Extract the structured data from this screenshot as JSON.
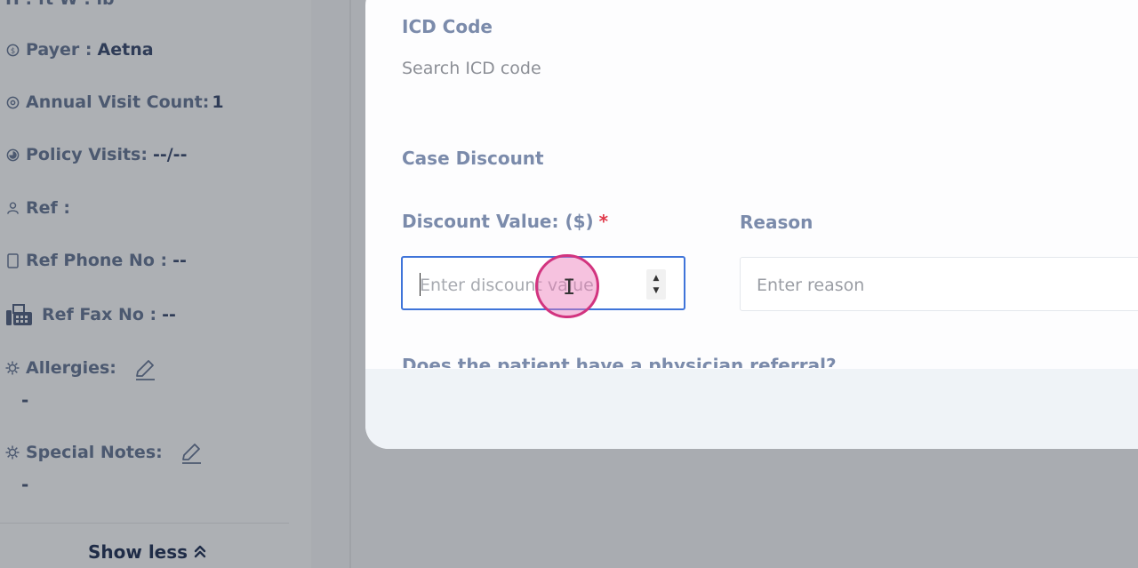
{
  "sidebar": {
    "top_partial": "H : ft W : lb",
    "rows": [
      {
        "icon": "dollar-icon",
        "label": "Payer :",
        "value": "Aetna"
      },
      {
        "icon": "eye-icon",
        "label": "Annual Visit Count:",
        "value": "1"
      },
      {
        "icon": "pie-icon",
        "label": "Policy Visits:",
        "value": "--/--"
      },
      {
        "icon": "user-icon",
        "label": "Ref :",
        "value": ""
      },
      {
        "icon": "phone-icon",
        "label": "Ref Phone No :",
        "value": "--"
      },
      {
        "icon": "fax-icon",
        "label": "Ref Fax No :",
        "value": "--"
      },
      {
        "icon": "allergy-icon",
        "label": "Allergies:",
        "value": ""
      },
      {
        "icon": "notes-icon",
        "label": "Special Notes:",
        "value": ""
      }
    ],
    "allergies_value": "-",
    "notes_value": "-",
    "show_less": "Show less"
  },
  "modal": {
    "icd_label": "ICD Code",
    "icd_placeholder": "Search ICD code",
    "case_discount_label": "Case Discount",
    "discount_label": "Discount Value: ($)",
    "required_mark": "*",
    "discount_placeholder": "Enter discount value",
    "reason_label": "Reason",
    "reason_placeholder": "Enter reason",
    "referral_question": "Does the patient have a physician referral?"
  }
}
